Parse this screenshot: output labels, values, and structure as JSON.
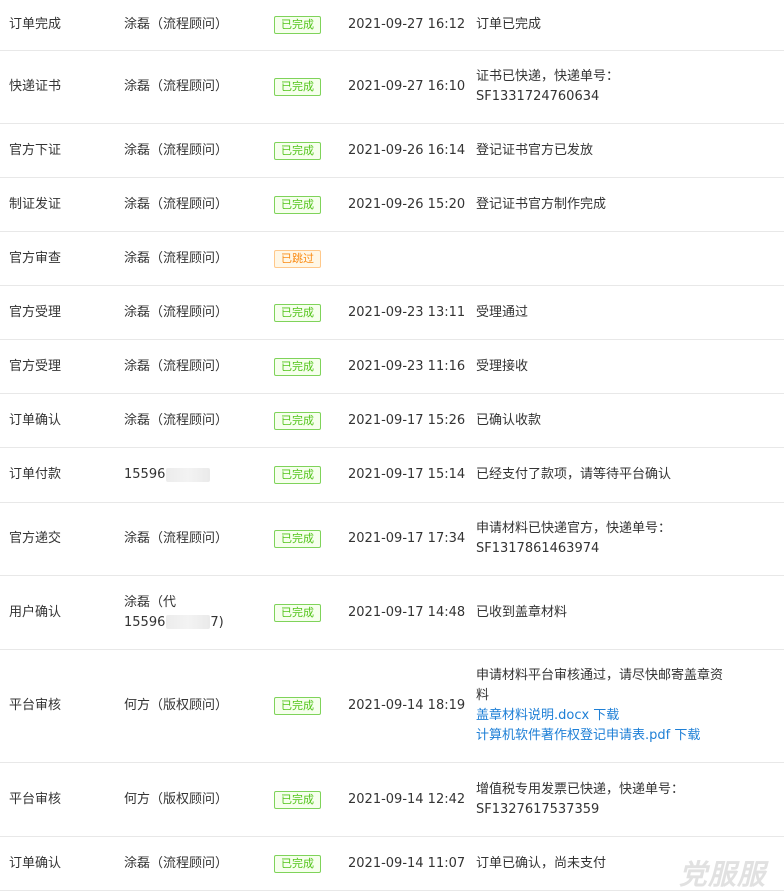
{
  "rows": [
    {
      "stage": "订单完成",
      "operator": "涂磊（流程顾问）",
      "status": "已完成",
      "time": "2021-09-27 16:12",
      "remark": [
        "订单已完成"
      ]
    },
    {
      "stage": "快递证书",
      "operator": "涂磊（流程顾问）",
      "status": "已完成",
      "time": "2021-09-27 16:10",
      "remark": [
        "证书已快递，快递单号：",
        "SF1331724760634"
      ]
    },
    {
      "stage": "官方下证",
      "operator": "涂磊（流程顾问）",
      "status": "已完成",
      "time": "2021-09-26 16:14",
      "remark": [
        "登记证书官方已发放"
      ]
    },
    {
      "stage": "制证发证",
      "operator": "涂磊（流程顾问）",
      "status": "已完成",
      "time": "2021-09-26 15:20",
      "remark": [
        "登记证书官方制作完成"
      ]
    },
    {
      "stage": "官方审查",
      "operator": "涂磊（流程顾问）",
      "status": "已跳过",
      "time": "",
      "remark": []
    },
    {
      "stage": "官方受理",
      "operator": "涂磊（流程顾问）",
      "status": "已完成",
      "time": "2021-09-23 13:11",
      "remark": [
        "受理通过"
      ]
    },
    {
      "stage": "官方受理",
      "operator": "涂磊（流程顾问）",
      "status": "已完成",
      "time": "2021-09-23 11:16",
      "remark": [
        "受理接收"
      ]
    },
    {
      "stage": "订单确认",
      "operator": "涂磊（流程顾问）",
      "status": "已完成",
      "time": "2021-09-17 15:26",
      "remark": [
        "已确认收款"
      ]
    },
    {
      "stage": "订单付款",
      "operator": "15596",
      "status": "已完成",
      "time": "2021-09-17 15:14",
      "remark": [
        "已经支付了款项，请等待平台确认"
      ]
    },
    {
      "stage": "官方递交",
      "operator": "涂磊（流程顾问）",
      "status": "已完成",
      "time": "2021-09-17 17:34",
      "remark": [
        "申请材料已快递官方，快递单号：",
        "SF1317861463974"
      ]
    },
    {
      "stage": "用户确认",
      "operator": "涂磊（代",
      "operator2": "15596",
      "operator2_tail": "7)",
      "status": "已完成",
      "time": "2021-09-17 14:48",
      "remark": [
        "已收到盖章材料"
      ]
    },
    {
      "stage": "平台审核",
      "operator": "何方（版权顾问）",
      "status": "已完成",
      "time": "2021-09-14 18:19",
      "remark": [
        "申请材料平台审核通过，请尽快邮寄盖章资",
        "料"
      ],
      "links": [
        "盖章材料说明.docx 下载",
        "计算机软件著作权登记申请表.pdf 下载"
      ]
    },
    {
      "stage": "平台审核",
      "operator": "何方（版权顾问）",
      "status": "已完成",
      "time": "2021-09-14 12:42",
      "remark": [
        "增值税专用发票已快递，快递单号：",
        "SF1327617537359"
      ]
    },
    {
      "stage": "订单确认",
      "operator": "涂磊（流程顾问）",
      "status": "已完成",
      "time": "2021-09-14 11:07",
      "remark": [
        "订单已确认，尚未支付"
      ]
    }
  ],
  "watermark": "党服服"
}
